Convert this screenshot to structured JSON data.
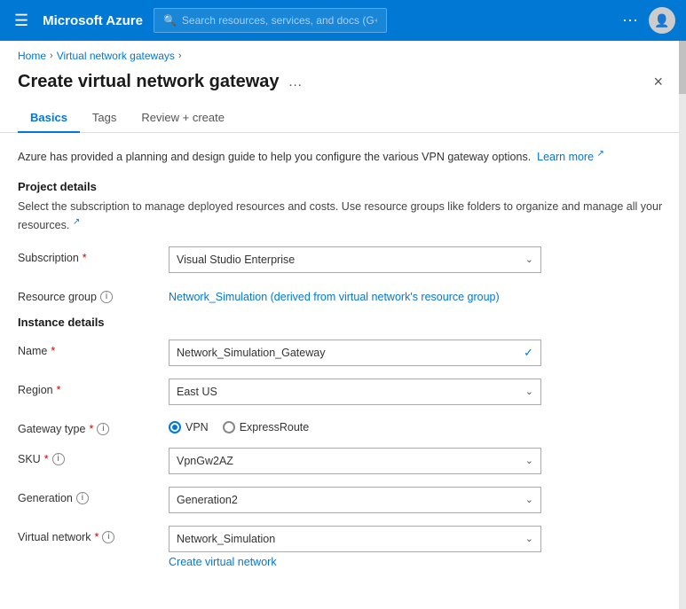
{
  "topbar": {
    "title": "Microsoft Azure",
    "search_placeholder": "Search resources, services, and docs (G+/)"
  },
  "breadcrumb": {
    "home": "Home",
    "parent": "Virtual network gateways"
  },
  "page": {
    "title": "Create virtual network gateway",
    "close_label": "×"
  },
  "tabs": [
    {
      "id": "basics",
      "label": "Basics",
      "active": true
    },
    {
      "id": "tags",
      "label": "Tags",
      "active": false
    },
    {
      "id": "review",
      "label": "Review + create",
      "active": false
    }
  ],
  "info_banner": {
    "text": "Azure has provided a planning and design guide to help you configure the various VPN gateway options.",
    "link_text": "Learn more",
    "link_icon": "↗"
  },
  "sections": {
    "project_details": {
      "heading": "Project details",
      "description": "Select the subscription to manage deployed resources and costs. Use resource groups like folders to organize and manage all your resources.",
      "link_icon": "↗"
    },
    "instance_details": {
      "heading": "Instance details"
    }
  },
  "form": {
    "subscription": {
      "label": "Subscription",
      "required": true,
      "value": "Visual Studio Enterprise"
    },
    "resource_group": {
      "label": "Resource group",
      "has_info": true,
      "value": "Network_Simulation (derived from virtual network's resource group)"
    },
    "name": {
      "label": "Name",
      "required": true,
      "value": "Network_Simulation_Gateway",
      "has_check": true
    },
    "region": {
      "label": "Region",
      "required": true,
      "value": "East US"
    },
    "gateway_type": {
      "label": "Gateway type",
      "required": true,
      "has_info": true,
      "options": [
        {
          "id": "vpn",
          "label": "VPN",
          "selected": true
        },
        {
          "id": "expressroute",
          "label": "ExpressRoute",
          "selected": false
        }
      ]
    },
    "sku": {
      "label": "SKU",
      "required": true,
      "has_info": true,
      "value": "VpnGw2AZ"
    },
    "generation": {
      "label": "Generation",
      "has_info": true,
      "value": "Generation2"
    },
    "virtual_network": {
      "label": "Virtual network",
      "required": true,
      "has_info": true,
      "value": "Network_Simulation",
      "create_link": "Create virtual network"
    }
  }
}
